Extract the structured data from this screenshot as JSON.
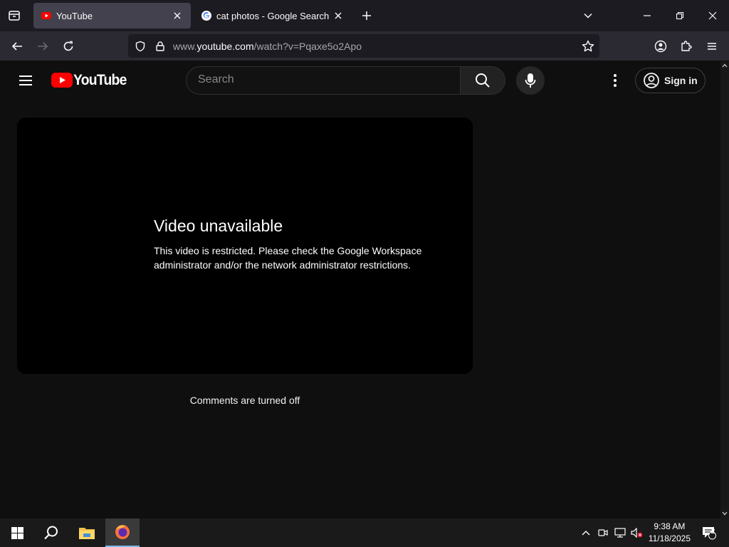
{
  "browser": {
    "tabs": [
      {
        "title": "YouTube",
        "active": true
      },
      {
        "title": "cat photos - Google Search",
        "active": false
      }
    ],
    "url": {
      "prefix": "www.",
      "host": "youtube.com",
      "path": "/watch?v=Pqaxe5o2Apo"
    }
  },
  "youtube": {
    "logo_text": "YouTube",
    "search": {
      "placeholder": "Search"
    },
    "sign_in_label": "Sign in",
    "player": {
      "error_title": "Video unavailable",
      "error_message": "This video is restricted. Please check the Google Workspace administrator and/or the network administrator restrictions."
    },
    "comments_status": "Comments are turned off"
  },
  "taskbar": {
    "time": "9:38 AM",
    "date": "11/18/2025",
    "notification_count": "2"
  },
  "colors": {
    "yt_red": "#ff0000",
    "browser_bg": "#1c1b22",
    "page_bg": "#0f0f0f"
  }
}
